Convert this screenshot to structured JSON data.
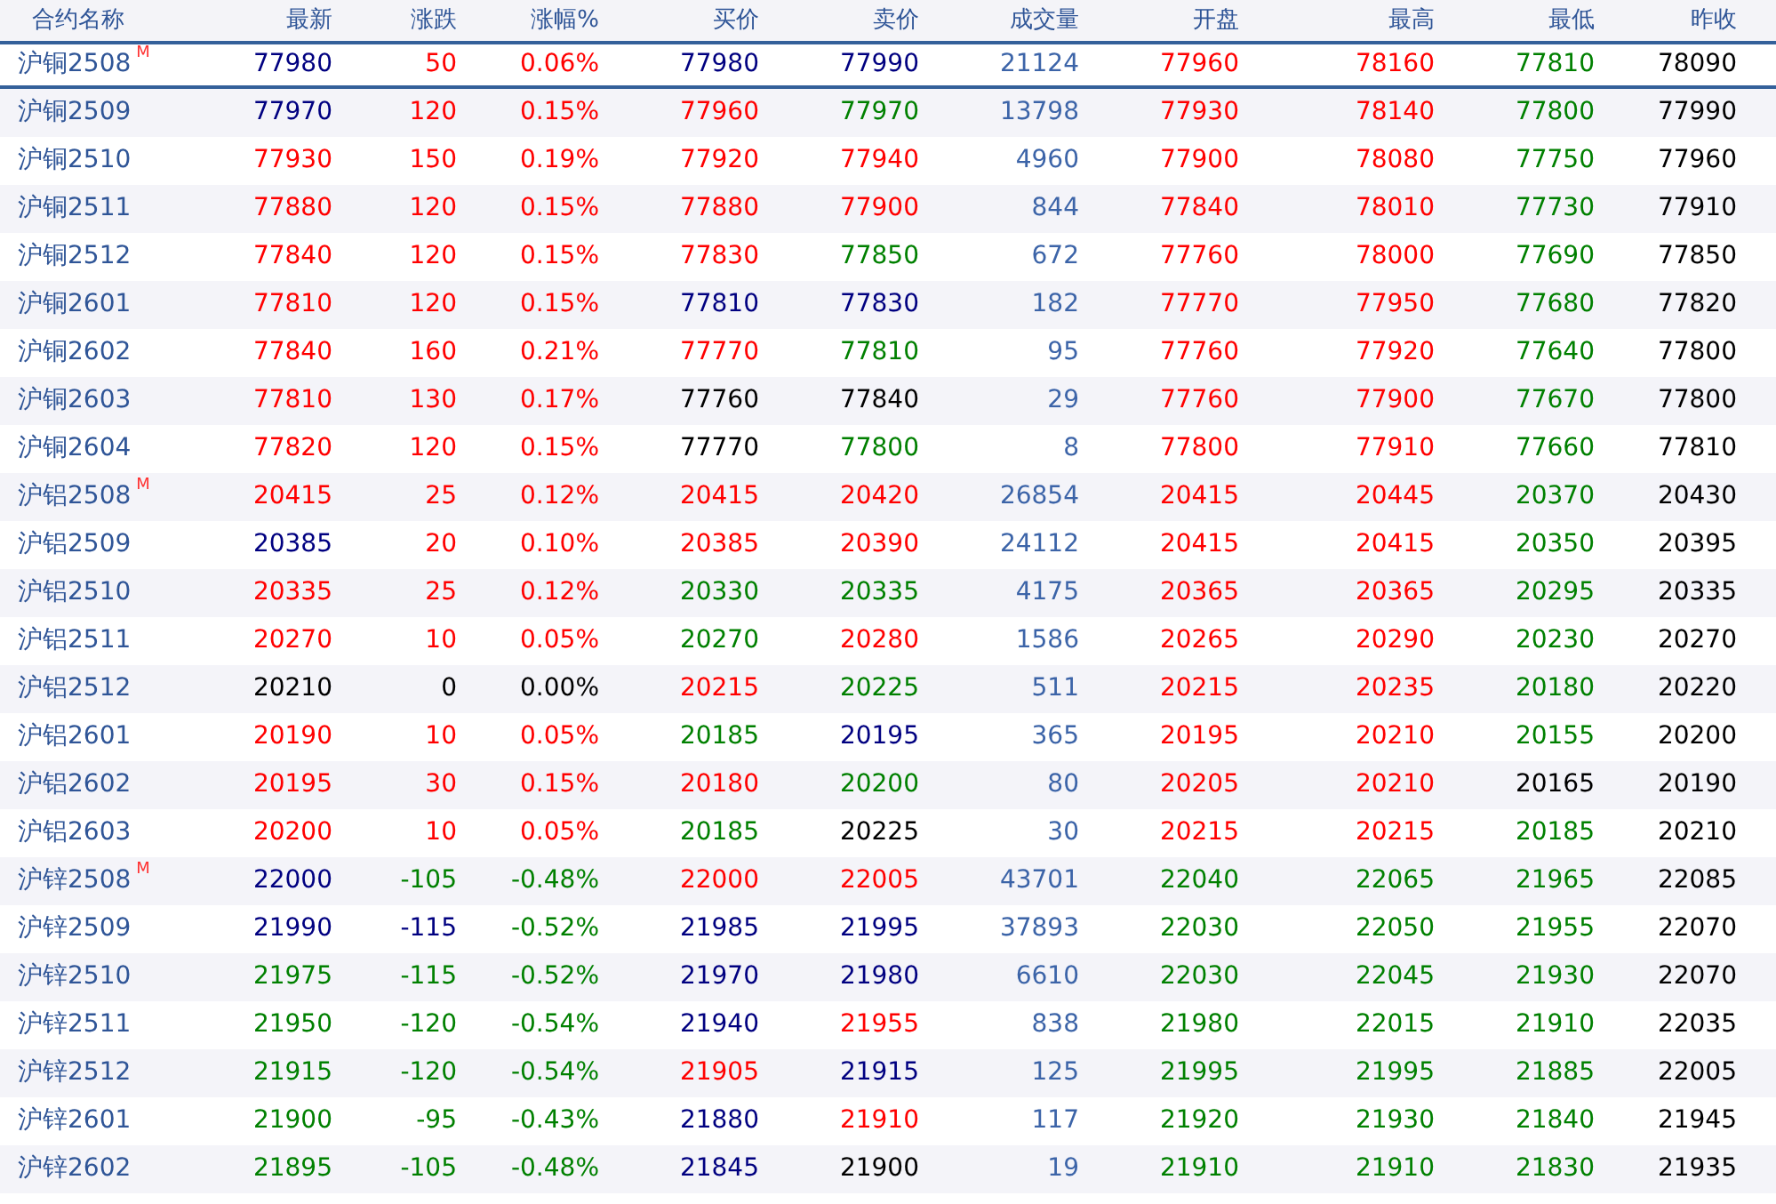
{
  "table": {
    "columns": [
      "合约名称",
      "最新",
      "涨跌",
      "涨幅%",
      "买价",
      "卖价",
      "成交量",
      "开盘",
      "最高",
      "最低",
      "昨收"
    ],
    "rows": [
      {
        "selected": true,
        "cells": [
          {
            "text": "沪铜2508",
            "mark": "M"
          },
          {
            "text": "77980",
            "color": "#000080"
          },
          {
            "text": "50",
            "color": "#ff0000"
          },
          {
            "text": "0.06%",
            "color": "#ff0000"
          },
          {
            "text": "77980",
            "color": "#000080"
          },
          {
            "text": "77990",
            "color": "#000080"
          },
          {
            "text": "21124",
            "color": "#3c64a8"
          },
          {
            "text": "77960",
            "color": "#ff0000"
          },
          {
            "text": "78160",
            "color": "#ff0000"
          },
          {
            "text": "77810",
            "color": "#008000"
          },
          {
            "text": "78090",
            "color": "#000000"
          }
        ]
      },
      {
        "selected": false,
        "cells": [
          {
            "text": "沪铜2509"
          },
          {
            "text": "77970",
            "color": "#000080"
          },
          {
            "text": "120",
            "color": "#ff0000"
          },
          {
            "text": "0.15%",
            "color": "#ff0000"
          },
          {
            "text": "77960",
            "color": "#ff0000"
          },
          {
            "text": "77970",
            "color": "#008000"
          },
          {
            "text": "13798",
            "color": "#3c64a8"
          },
          {
            "text": "77930",
            "color": "#ff0000"
          },
          {
            "text": "78140",
            "color": "#ff0000"
          },
          {
            "text": "77800",
            "color": "#008000"
          },
          {
            "text": "77990",
            "color": "#000000"
          }
        ]
      },
      {
        "selected": false,
        "cells": [
          {
            "text": "沪铜2510"
          },
          {
            "text": "77930",
            "color": "#ff0000"
          },
          {
            "text": "150",
            "color": "#ff0000"
          },
          {
            "text": "0.19%",
            "color": "#ff0000"
          },
          {
            "text": "77920",
            "color": "#ff0000"
          },
          {
            "text": "77940",
            "color": "#ff0000"
          },
          {
            "text": "4960",
            "color": "#3c64a8"
          },
          {
            "text": "77900",
            "color": "#ff0000"
          },
          {
            "text": "78080",
            "color": "#ff0000"
          },
          {
            "text": "77750",
            "color": "#008000"
          },
          {
            "text": "77960",
            "color": "#000000"
          }
        ]
      },
      {
        "selected": false,
        "cells": [
          {
            "text": "沪铜2511"
          },
          {
            "text": "77880",
            "color": "#ff0000"
          },
          {
            "text": "120",
            "color": "#ff0000"
          },
          {
            "text": "0.15%",
            "color": "#ff0000"
          },
          {
            "text": "77880",
            "color": "#ff0000"
          },
          {
            "text": "77900",
            "color": "#ff0000"
          },
          {
            "text": "844",
            "color": "#3c64a8"
          },
          {
            "text": "77840",
            "color": "#ff0000"
          },
          {
            "text": "78010",
            "color": "#ff0000"
          },
          {
            "text": "77730",
            "color": "#008000"
          },
          {
            "text": "77910",
            "color": "#000000"
          }
        ]
      },
      {
        "selected": false,
        "cells": [
          {
            "text": "沪铜2512"
          },
          {
            "text": "77840",
            "color": "#ff0000"
          },
          {
            "text": "120",
            "color": "#ff0000"
          },
          {
            "text": "0.15%",
            "color": "#ff0000"
          },
          {
            "text": "77830",
            "color": "#ff0000"
          },
          {
            "text": "77850",
            "color": "#008000"
          },
          {
            "text": "672",
            "color": "#3c64a8"
          },
          {
            "text": "77760",
            "color": "#ff0000"
          },
          {
            "text": "78000",
            "color": "#ff0000"
          },
          {
            "text": "77690",
            "color": "#008000"
          },
          {
            "text": "77850",
            "color": "#000000"
          }
        ]
      },
      {
        "selected": false,
        "cells": [
          {
            "text": "沪铜2601"
          },
          {
            "text": "77810",
            "color": "#ff0000"
          },
          {
            "text": "120",
            "color": "#ff0000"
          },
          {
            "text": "0.15%",
            "color": "#ff0000"
          },
          {
            "text": "77810",
            "color": "#000080"
          },
          {
            "text": "77830",
            "color": "#000080"
          },
          {
            "text": "182",
            "color": "#3c64a8"
          },
          {
            "text": "77770",
            "color": "#ff0000"
          },
          {
            "text": "77950",
            "color": "#ff0000"
          },
          {
            "text": "77680",
            "color": "#008000"
          },
          {
            "text": "77820",
            "color": "#000000"
          }
        ]
      },
      {
        "selected": false,
        "cells": [
          {
            "text": "沪铜2602"
          },
          {
            "text": "77840",
            "color": "#ff0000"
          },
          {
            "text": "160",
            "color": "#ff0000"
          },
          {
            "text": "0.21%",
            "color": "#ff0000"
          },
          {
            "text": "77770",
            "color": "#ff0000"
          },
          {
            "text": "77810",
            "color": "#008000"
          },
          {
            "text": "95",
            "color": "#3c64a8"
          },
          {
            "text": "77760",
            "color": "#ff0000"
          },
          {
            "text": "77920",
            "color": "#ff0000"
          },
          {
            "text": "77640",
            "color": "#008000"
          },
          {
            "text": "77800",
            "color": "#000000"
          }
        ]
      },
      {
        "selected": false,
        "cells": [
          {
            "text": "沪铜2603"
          },
          {
            "text": "77810",
            "color": "#ff0000"
          },
          {
            "text": "130",
            "color": "#ff0000"
          },
          {
            "text": "0.17%",
            "color": "#ff0000"
          },
          {
            "text": "77760",
            "color": "#000000"
          },
          {
            "text": "77840",
            "color": "#000000"
          },
          {
            "text": "29",
            "color": "#3c64a8"
          },
          {
            "text": "77760",
            "color": "#ff0000"
          },
          {
            "text": "77900",
            "color": "#ff0000"
          },
          {
            "text": "77670",
            "color": "#008000"
          },
          {
            "text": "77800",
            "color": "#000000"
          }
        ]
      },
      {
        "selected": false,
        "cells": [
          {
            "text": "沪铜2604"
          },
          {
            "text": "77820",
            "color": "#ff0000"
          },
          {
            "text": "120",
            "color": "#ff0000"
          },
          {
            "text": "0.15%",
            "color": "#ff0000"
          },
          {
            "text": "77770",
            "color": "#000000"
          },
          {
            "text": "77800",
            "color": "#008000"
          },
          {
            "text": "8",
            "color": "#3c64a8"
          },
          {
            "text": "77800",
            "color": "#ff0000"
          },
          {
            "text": "77910",
            "color": "#ff0000"
          },
          {
            "text": "77660",
            "color": "#008000"
          },
          {
            "text": "77810",
            "color": "#000000"
          }
        ]
      },
      {
        "selected": false,
        "cells": [
          {
            "text": "沪铝2508",
            "mark": "M"
          },
          {
            "text": "20415",
            "color": "#ff0000"
          },
          {
            "text": "25",
            "color": "#ff0000"
          },
          {
            "text": "0.12%",
            "color": "#ff0000"
          },
          {
            "text": "20415",
            "color": "#ff0000"
          },
          {
            "text": "20420",
            "color": "#ff0000"
          },
          {
            "text": "26854",
            "color": "#3c64a8"
          },
          {
            "text": "20415",
            "color": "#ff0000"
          },
          {
            "text": "20445",
            "color": "#ff0000"
          },
          {
            "text": "20370",
            "color": "#008000"
          },
          {
            "text": "20430",
            "color": "#000000"
          }
        ]
      },
      {
        "selected": false,
        "cells": [
          {
            "text": "沪铝2509"
          },
          {
            "text": "20385",
            "color": "#000080"
          },
          {
            "text": "20",
            "color": "#ff0000"
          },
          {
            "text": "0.10%",
            "color": "#ff0000"
          },
          {
            "text": "20385",
            "color": "#ff0000"
          },
          {
            "text": "20390",
            "color": "#ff0000"
          },
          {
            "text": "24112",
            "color": "#3c64a8"
          },
          {
            "text": "20415",
            "color": "#ff0000"
          },
          {
            "text": "20415",
            "color": "#ff0000"
          },
          {
            "text": "20350",
            "color": "#008000"
          },
          {
            "text": "20395",
            "color": "#000000"
          }
        ]
      },
      {
        "selected": false,
        "cells": [
          {
            "text": "沪铝2510"
          },
          {
            "text": "20335",
            "color": "#ff0000"
          },
          {
            "text": "25",
            "color": "#ff0000"
          },
          {
            "text": "0.12%",
            "color": "#ff0000"
          },
          {
            "text": "20330",
            "color": "#008000"
          },
          {
            "text": "20335",
            "color": "#008000"
          },
          {
            "text": "4175",
            "color": "#3c64a8"
          },
          {
            "text": "20365",
            "color": "#ff0000"
          },
          {
            "text": "20365",
            "color": "#ff0000"
          },
          {
            "text": "20295",
            "color": "#008000"
          },
          {
            "text": "20335",
            "color": "#000000"
          }
        ]
      },
      {
        "selected": false,
        "cells": [
          {
            "text": "沪铝2511"
          },
          {
            "text": "20270",
            "color": "#ff0000"
          },
          {
            "text": "10",
            "color": "#ff0000"
          },
          {
            "text": "0.05%",
            "color": "#ff0000"
          },
          {
            "text": "20270",
            "color": "#008000"
          },
          {
            "text": "20280",
            "color": "#ff0000"
          },
          {
            "text": "1586",
            "color": "#3c64a8"
          },
          {
            "text": "20265",
            "color": "#ff0000"
          },
          {
            "text": "20290",
            "color": "#ff0000"
          },
          {
            "text": "20230",
            "color": "#008000"
          },
          {
            "text": "20270",
            "color": "#000000"
          }
        ]
      },
      {
        "selected": false,
        "cells": [
          {
            "text": "沪铝2512"
          },
          {
            "text": "20210",
            "color": "#000000"
          },
          {
            "text": "0",
            "color": "#000000"
          },
          {
            "text": "0.00%",
            "color": "#000000"
          },
          {
            "text": "20215",
            "color": "#ff0000"
          },
          {
            "text": "20225",
            "color": "#008000"
          },
          {
            "text": "511",
            "color": "#3c64a8"
          },
          {
            "text": "20215",
            "color": "#ff0000"
          },
          {
            "text": "20235",
            "color": "#ff0000"
          },
          {
            "text": "20180",
            "color": "#008000"
          },
          {
            "text": "20220",
            "color": "#000000"
          }
        ]
      },
      {
        "selected": false,
        "cells": [
          {
            "text": "沪铝2601"
          },
          {
            "text": "20190",
            "color": "#ff0000"
          },
          {
            "text": "10",
            "color": "#ff0000"
          },
          {
            "text": "0.05%",
            "color": "#ff0000"
          },
          {
            "text": "20185",
            "color": "#008000"
          },
          {
            "text": "20195",
            "color": "#000080"
          },
          {
            "text": "365",
            "color": "#3c64a8"
          },
          {
            "text": "20195",
            "color": "#ff0000"
          },
          {
            "text": "20210",
            "color": "#ff0000"
          },
          {
            "text": "20155",
            "color": "#008000"
          },
          {
            "text": "20200",
            "color": "#000000"
          }
        ]
      },
      {
        "selected": false,
        "cells": [
          {
            "text": "沪铝2602"
          },
          {
            "text": "20195",
            "color": "#ff0000"
          },
          {
            "text": "30",
            "color": "#ff0000"
          },
          {
            "text": "0.15%",
            "color": "#ff0000"
          },
          {
            "text": "20180",
            "color": "#ff0000"
          },
          {
            "text": "20200",
            "color": "#008000"
          },
          {
            "text": "80",
            "color": "#3c64a8"
          },
          {
            "text": "20205",
            "color": "#ff0000"
          },
          {
            "text": "20210",
            "color": "#ff0000"
          },
          {
            "text": "20165",
            "color": "#000000"
          },
          {
            "text": "20190",
            "color": "#000000"
          }
        ]
      },
      {
        "selected": false,
        "cells": [
          {
            "text": "沪铝2603"
          },
          {
            "text": "20200",
            "color": "#ff0000"
          },
          {
            "text": "10",
            "color": "#ff0000"
          },
          {
            "text": "0.05%",
            "color": "#ff0000"
          },
          {
            "text": "20185",
            "color": "#008000"
          },
          {
            "text": "20225",
            "color": "#000000"
          },
          {
            "text": "30",
            "color": "#3c64a8"
          },
          {
            "text": "20215",
            "color": "#ff0000"
          },
          {
            "text": "20215",
            "color": "#ff0000"
          },
          {
            "text": "20185",
            "color": "#008000"
          },
          {
            "text": "20210",
            "color": "#000000"
          }
        ]
      },
      {
        "selected": false,
        "cells": [
          {
            "text": "沪锌2508",
            "mark": "M"
          },
          {
            "text": "22000",
            "color": "#000080"
          },
          {
            "text": "-105",
            "color": "#008000"
          },
          {
            "text": "-0.48%",
            "color": "#008000"
          },
          {
            "text": "22000",
            "color": "#ff0000"
          },
          {
            "text": "22005",
            "color": "#ff0000"
          },
          {
            "text": "43701",
            "color": "#3c64a8"
          },
          {
            "text": "22040",
            "color": "#008000"
          },
          {
            "text": "22065",
            "color": "#008000"
          },
          {
            "text": "21965",
            "color": "#008000"
          },
          {
            "text": "22085",
            "color": "#000000"
          }
        ]
      },
      {
        "selected": false,
        "cells": [
          {
            "text": "沪锌2509"
          },
          {
            "text": "21990",
            "color": "#000080"
          },
          {
            "text": "-115",
            "color": "#000080"
          },
          {
            "text": "-0.52%",
            "color": "#008000"
          },
          {
            "text": "21985",
            "color": "#000080"
          },
          {
            "text": "21995",
            "color": "#000080"
          },
          {
            "text": "37893",
            "color": "#3c64a8"
          },
          {
            "text": "22030",
            "color": "#008000"
          },
          {
            "text": "22050",
            "color": "#008000"
          },
          {
            "text": "21955",
            "color": "#008000"
          },
          {
            "text": "22070",
            "color": "#000000"
          }
        ]
      },
      {
        "selected": false,
        "cells": [
          {
            "text": "沪锌2510"
          },
          {
            "text": "21975",
            "color": "#008000"
          },
          {
            "text": "-115",
            "color": "#008000"
          },
          {
            "text": "-0.52%",
            "color": "#008000"
          },
          {
            "text": "21970",
            "color": "#000080"
          },
          {
            "text": "21980",
            "color": "#000080"
          },
          {
            "text": "6610",
            "color": "#3c64a8"
          },
          {
            "text": "22030",
            "color": "#008000"
          },
          {
            "text": "22045",
            "color": "#008000"
          },
          {
            "text": "21930",
            "color": "#008000"
          },
          {
            "text": "22070",
            "color": "#000000"
          }
        ]
      },
      {
        "selected": false,
        "cells": [
          {
            "text": "沪锌2511"
          },
          {
            "text": "21950",
            "color": "#008000"
          },
          {
            "text": "-120",
            "color": "#008000"
          },
          {
            "text": "-0.54%",
            "color": "#008000"
          },
          {
            "text": "21940",
            "color": "#000080"
          },
          {
            "text": "21955",
            "color": "#ff0000"
          },
          {
            "text": "838",
            "color": "#3c64a8"
          },
          {
            "text": "21980",
            "color": "#008000"
          },
          {
            "text": "22015",
            "color": "#008000"
          },
          {
            "text": "21910",
            "color": "#008000"
          },
          {
            "text": "22035",
            "color": "#000000"
          }
        ]
      },
      {
        "selected": false,
        "cells": [
          {
            "text": "沪锌2512"
          },
          {
            "text": "21915",
            "color": "#008000"
          },
          {
            "text": "-120",
            "color": "#008000"
          },
          {
            "text": "-0.54%",
            "color": "#008000"
          },
          {
            "text": "21905",
            "color": "#ff0000"
          },
          {
            "text": "21915",
            "color": "#000080"
          },
          {
            "text": "125",
            "color": "#3c64a8"
          },
          {
            "text": "21995",
            "color": "#008000"
          },
          {
            "text": "21995",
            "color": "#008000"
          },
          {
            "text": "21885",
            "color": "#008000"
          },
          {
            "text": "22005",
            "color": "#000000"
          }
        ]
      },
      {
        "selected": false,
        "cells": [
          {
            "text": "沪锌2601"
          },
          {
            "text": "21900",
            "color": "#008000"
          },
          {
            "text": "-95",
            "color": "#008000"
          },
          {
            "text": "-0.43%",
            "color": "#008000"
          },
          {
            "text": "21880",
            "color": "#000080"
          },
          {
            "text": "21910",
            "color": "#ff0000"
          },
          {
            "text": "117",
            "color": "#3c64a8"
          },
          {
            "text": "21920",
            "color": "#008000"
          },
          {
            "text": "21930",
            "color": "#008000"
          },
          {
            "text": "21840",
            "color": "#008000"
          },
          {
            "text": "21945",
            "color": "#000000"
          }
        ]
      },
      {
        "selected": false,
        "cells": [
          {
            "text": "沪锌2602"
          },
          {
            "text": "21895",
            "color": "#008000"
          },
          {
            "text": "-105",
            "color": "#008000"
          },
          {
            "text": "-0.48%",
            "color": "#008000"
          },
          {
            "text": "21845",
            "color": "#000080"
          },
          {
            "text": "21900",
            "color": "#000000"
          },
          {
            "text": "19",
            "color": "#3c64a8"
          },
          {
            "text": "21910",
            "color": "#008000"
          },
          {
            "text": "21910",
            "color": "#008000"
          },
          {
            "text": "21830",
            "color": "#008000"
          },
          {
            "text": "21935",
            "color": "#000000"
          }
        ]
      }
    ]
  }
}
